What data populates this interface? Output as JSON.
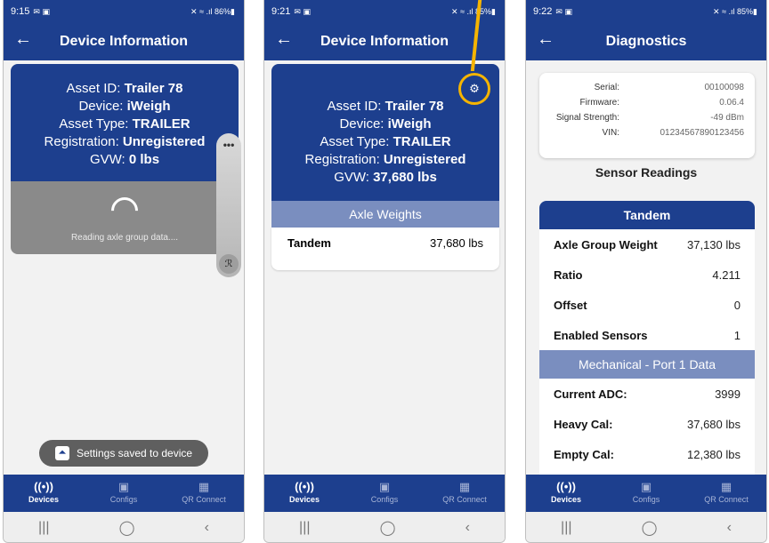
{
  "colors": {
    "brand": "#1d3f8e",
    "accent": "#f5b400",
    "subheader": "#7a8ebf"
  },
  "phones": [
    {
      "status": {
        "time": "9:15",
        "notif": "✉ ▣",
        "right": "✕ ≈ .ıl 86%▮"
      },
      "appbar": {
        "title": "Device Information"
      },
      "info": {
        "asset_id_label": "Asset ID: ",
        "asset_id": "Trailer 78",
        "device_label": "Device: ",
        "device": "iWeigh",
        "asset_type_label": "Asset Type: ",
        "asset_type": "TRAILER",
        "registration_label": "Registration: ",
        "registration": "Unregistered",
        "gvw_label": "GVW: ",
        "gvw": "0 lbs"
      },
      "loading_text": "Reading axle group data....",
      "side_menu_dots": "•••",
      "side_handle_icon": "ℛ",
      "toast": {
        "text": "Settings saved to device",
        "icon": "⏶"
      },
      "progress_pct": null
    },
    {
      "status": {
        "time": "9:21",
        "notif": "✉ ▣",
        "right": "✕ ≈ .ıl 85%▮"
      },
      "appbar": {
        "title": "Device Information"
      },
      "info": {
        "asset_id_label": "Asset ID: ",
        "asset_id": "Trailer 78",
        "device_label": "Device: ",
        "device": "iWeigh",
        "asset_type_label": "Asset Type: ",
        "asset_type": "TRAILER",
        "registration_label": "Registration: ",
        "registration": "Unregistered",
        "gvw_label": "GVW: ",
        "gvw": "37,680 lbs"
      },
      "settings_icon": "⚙",
      "axle": {
        "header": "Axle Weights",
        "name": "Tandem",
        "weight": "37,680 lbs"
      }
    },
    {
      "status": {
        "time": "9:22",
        "notif": "✉ ▣",
        "right": "✕ ≈ .ıl 85%▮"
      },
      "appbar": {
        "title": "Diagnostics"
      },
      "diag": [
        {
          "k": "Serial:",
          "v": "00100098"
        },
        {
          "k": "Firmware:",
          "v": "0.06.4"
        },
        {
          "k": "Signal Strength:",
          "v": "-49 dBm"
        },
        {
          "k": "VIN:",
          "v": "01234567890123456"
        }
      ],
      "sensor_title": "Sensor Readings",
      "tandem_header": "Tandem",
      "tandem_rows": [
        {
          "k": "Axle Group Weight",
          "v": "37,130 lbs"
        },
        {
          "k": "Ratio",
          "v": "4.211"
        },
        {
          "k": "Offset",
          "v": "0"
        },
        {
          "k": "Enabled Sensors",
          "v": "1"
        }
      ],
      "mech_header": "Mechanical - Port 1 Data",
      "mech_rows": [
        {
          "k": "Current ADC:",
          "v": "3999"
        },
        {
          "k": "Heavy Cal:",
          "v": "37,680 lbs"
        },
        {
          "k": "Empty Cal:",
          "v": "12,380 lbs"
        }
      ]
    }
  ],
  "bottomnav": [
    {
      "label": "Devices",
      "icon": "((•))"
    },
    {
      "label": "Configs",
      "icon": "▣"
    },
    {
      "label": "QR Connect",
      "icon": "▦"
    }
  ],
  "sysnav": {
    "recent": "|||",
    "home": "◯",
    "back": "‹"
  }
}
